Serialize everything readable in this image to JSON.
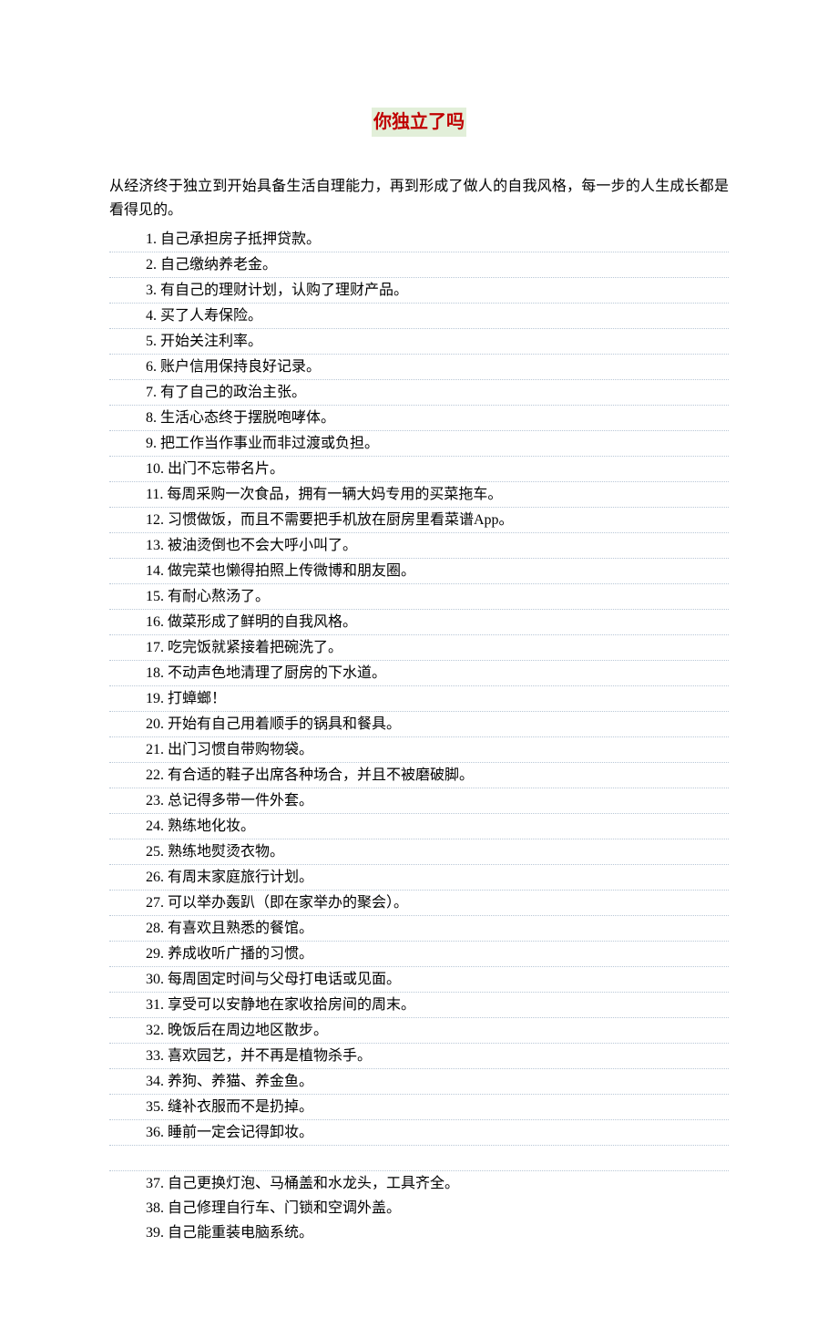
{
  "title": "你独立了吗",
  "intro": "从经济终于独立到开始具备生活自理能力，再到形成了做人的自我风格，每一步的人生成长都是看得见的。",
  "items": [
    "自己承担房子抵押贷款。",
    "自己缴纳养老金。",
    "有自己的理财计划，认购了理财产品。",
    "买了人寿保险。",
    "开始关注利率。",
    "账户信用保持良好记录。",
    "有了自己的政治主张。",
    "生活心态终于摆脱咆哮体。",
    "把工作当作事业而非过渡或负担。",
    "出门不忘带名片。",
    "每周采购一次食品，拥有一辆大妈专用的买菜拖车。",
    "习惯做饭，而且不需要把手机放在厨房里看菜谱App。",
    "被油烫倒也不会大呼小叫了。",
    "做完菜也懒得拍照上传微博和朋友圈。",
    "有耐心熬汤了。",
    "做菜形成了鲜明的自我风格。",
    "吃完饭就紧接着把碗洗了。",
    "不动声色地清理了厨房的下水道。",
    "打蟑螂！",
    "开始有自己用着顺手的锅具和餐具。",
    "出门习惯自带购物袋。",
    "有合适的鞋子出席各种场合，并且不被磨破脚。",
    "总记得多带一件外套。",
    "熟练地化妆。",
    "熟练地熨烫衣物。",
    "有周末家庭旅行计划。",
    "可以举办轰趴（即在家举办的聚会）。",
    "有喜欢且熟悉的餐馆。",
    "养成收听广播的习惯。",
    "每周固定时间与父母打电话或见面。",
    "享受可以安静地在家收拾房间的周末。",
    "晚饭后在周边地区散步。",
    "喜欢园艺，并不再是植物杀手。",
    "养狗、养猫、养金鱼。",
    "缝补衣服而不是扔掉。",
    "睡前一定会记得卸妆。",
    "自己更换灯泡、马桶盖和水龙头，工具齐全。",
    "自己修理自行车、门锁和空调外盖。",
    "自己能重装电脑系统。"
  ],
  "gap_after_index": 35
}
